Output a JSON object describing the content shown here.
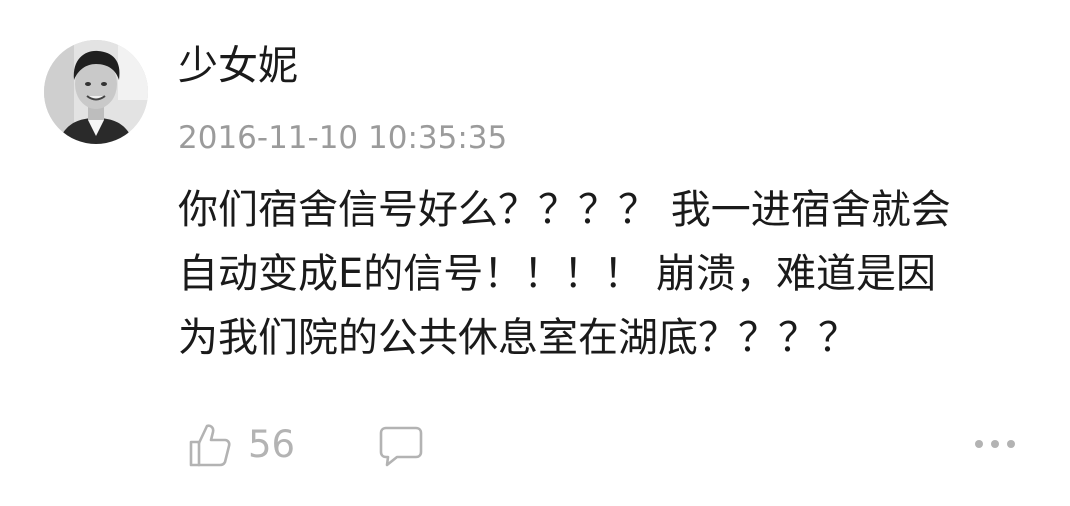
{
  "comment": {
    "username": "少女妮",
    "timestamp": "2016-11-10 10:35:35",
    "content_lines": [
      "你们宿舍信号好么？？？？ 我一进宿舍就会",
      "自动变成E的信号！！！！ 崩溃，难道是因",
      "为我们院的公共休息室在湖底？？？？"
    ],
    "likes": "56"
  },
  "icons": {
    "like": "thumbs-up-icon",
    "reply": "comment-bubble-icon",
    "more": "more-dots-icon"
  },
  "colors": {
    "text": "#1a1a1a",
    "secondary": "#9b9b9b",
    "icon": "#b3b3b3"
  }
}
